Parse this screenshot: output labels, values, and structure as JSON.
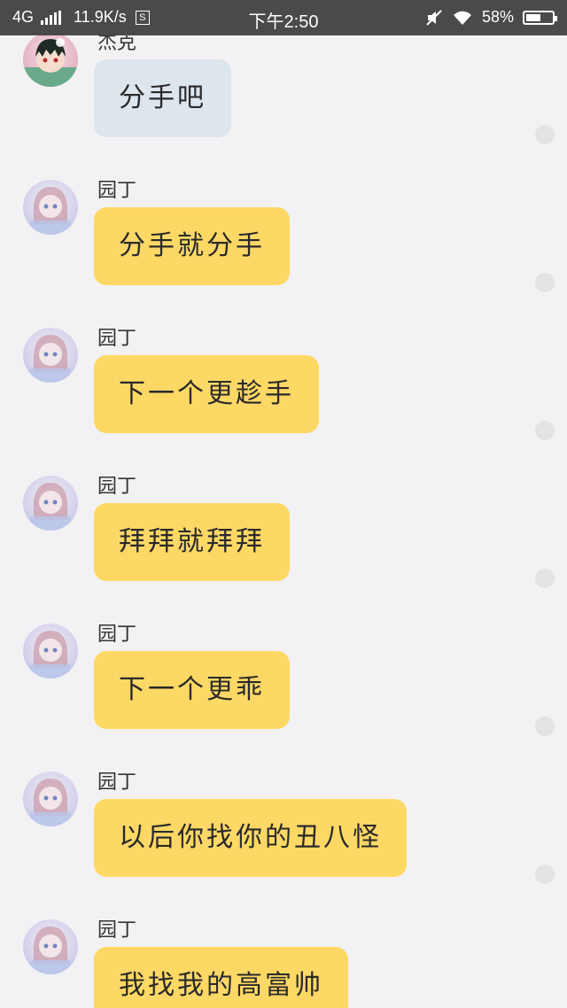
{
  "status_bar": {
    "network": "4G",
    "speed": "11.9K/s",
    "s_icon": "S",
    "time": "下午2:50",
    "battery_percent": "58%",
    "battery_level": 0.58,
    "icons": [
      "signal-icon",
      "s-box-icon",
      "mute-icon",
      "wifi-icon",
      "battery-icon"
    ]
  },
  "messages": [
    {
      "sender": "杰克",
      "text": "分手吧",
      "style": "gray",
      "avatar": "boy-avatar"
    },
    {
      "sender": "园丁",
      "text": "分手就分手",
      "style": "yellow",
      "avatar": "girl-avatar"
    },
    {
      "sender": "园丁",
      "text": "下一个更趁手",
      "style": "yellow",
      "avatar": "girl-avatar"
    },
    {
      "sender": "园丁",
      "text": "拜拜就拜拜",
      "style": "yellow",
      "avatar": "girl-avatar"
    },
    {
      "sender": "园丁",
      "text": "下一个更乖",
      "style": "yellow",
      "avatar": "girl-avatar"
    },
    {
      "sender": "园丁",
      "text": "以后你找你的丑八怪",
      "style": "yellow",
      "avatar": "girl-avatar"
    },
    {
      "sender": "园丁",
      "text": "我找我的高富帅",
      "style": "yellow",
      "avatar": "girl-avatar"
    }
  ],
  "colors": {
    "status_bar": "#4a4a4a",
    "background": "#f2f2f4",
    "bubble_yellow": "#fdd865",
    "bubble_gray": "#dde5ed"
  }
}
